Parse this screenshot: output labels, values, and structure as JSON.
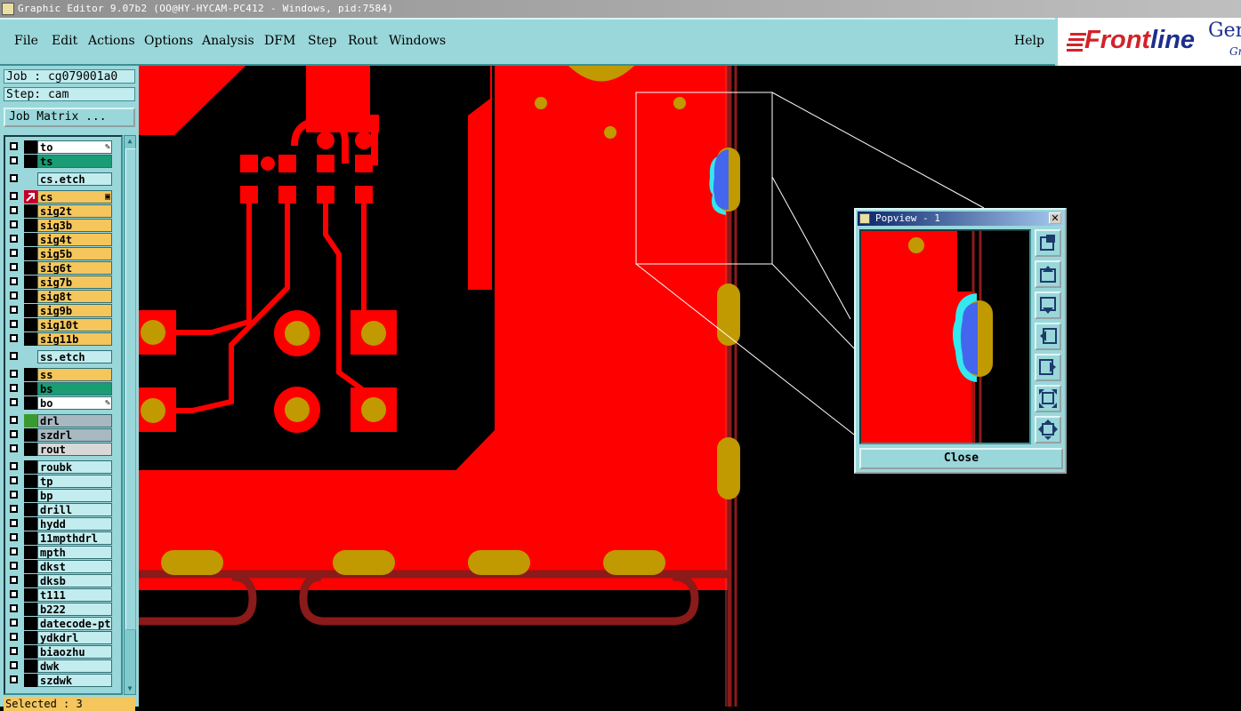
{
  "window": {
    "title": "Graphic Editor 9.07b2 (OO@HY-HYCAM-PC412 - Windows, pid:7584)"
  },
  "menu": {
    "file": "File",
    "edit": "Edit",
    "actions": "Actions",
    "options": "Options",
    "analysis": "Analysis",
    "dfm": "DFM",
    "step": "Step",
    "rout": "Rout",
    "windows": "Windows",
    "help": "Help"
  },
  "brand": {
    "logo_prefix": "Front",
    "logo_suffix": "line",
    "product": "Gen",
    "product_sub": "Gr"
  },
  "job": {
    "job_line": "Job : cg079001a0",
    "step_line": "Step: cam",
    "matrix_button": "Job Matrix ..."
  },
  "layers": [
    {
      "name": "to",
      "color": "#ffffff",
      "marker": "✎",
      "sq": "#000000"
    },
    {
      "name": "ts",
      "color": "#1a9c74",
      "marker": "",
      "sq": "#000000"
    },
    {
      "name": "cs.etch",
      "color": "#c2ecee",
      "marker": "",
      "sq": "#9ad7da"
    },
    {
      "name": "cs",
      "color": "#f5c65c",
      "marker": "▣",
      "sq": "#c0002a"
    },
    {
      "name": "sig2t",
      "color": "#f5c65c",
      "marker": "",
      "sq": "#000000"
    },
    {
      "name": "sig3b",
      "color": "#f5c65c",
      "marker": "",
      "sq": "#000000"
    },
    {
      "name": "sig4t",
      "color": "#f5c65c",
      "marker": "",
      "sq": "#000000"
    },
    {
      "name": "sig5b",
      "color": "#f5c65c",
      "marker": "",
      "sq": "#000000"
    },
    {
      "name": "sig6t",
      "color": "#f5c65c",
      "marker": "",
      "sq": "#000000"
    },
    {
      "name": "sig7b",
      "color": "#f5c65c",
      "marker": "",
      "sq": "#000000"
    },
    {
      "name": "sig8t",
      "color": "#f5c65c",
      "marker": "",
      "sq": "#000000"
    },
    {
      "name": "sig9b",
      "color": "#f5c65c",
      "marker": "",
      "sq": "#000000"
    },
    {
      "name": "sig10t",
      "color": "#f5c65c",
      "marker": "",
      "sq": "#000000"
    },
    {
      "name": "sig11b",
      "color": "#f5c65c",
      "marker": "",
      "sq": "#000000"
    },
    {
      "name": "ss.etch",
      "color": "#c2ecee",
      "marker": "",
      "sq": "#9ad7da"
    },
    {
      "name": "ss",
      "color": "#f5c65c",
      "marker": "",
      "sq": "#000000"
    },
    {
      "name": "bs",
      "color": "#1a9c74",
      "marker": "",
      "sq": "#000000"
    },
    {
      "name": "bo",
      "color": "#ffffff",
      "marker": "✎",
      "sq": "#000000"
    },
    {
      "name": "drl",
      "color": "#a8b8c0",
      "marker": "",
      "sq": "#3a9a30"
    },
    {
      "name": "szdrl",
      "color": "#a8b8c0",
      "marker": "",
      "sq": "#000000"
    },
    {
      "name": "rout",
      "color": "#d8d8d8",
      "marker": "",
      "sq": "#000000"
    },
    {
      "name": "roubk",
      "color": "#c2ecee",
      "marker": "",
      "sq": "#000000"
    },
    {
      "name": "tp",
      "color": "#c2ecee",
      "marker": "",
      "sq": "#000000"
    },
    {
      "name": "bp",
      "color": "#c2ecee",
      "marker": "",
      "sq": "#000000"
    },
    {
      "name": "drill",
      "color": "#c2ecee",
      "marker": "",
      "sq": "#000000"
    },
    {
      "name": "hydd",
      "color": "#c2ecee",
      "marker": "",
      "sq": "#000000"
    },
    {
      "name": "11mpthdrl",
      "color": "#c2ecee",
      "marker": "",
      "sq": "#000000"
    },
    {
      "name": "mpth",
      "color": "#c2ecee",
      "marker": "",
      "sq": "#000000"
    },
    {
      "name": "dkst",
      "color": "#c2ecee",
      "marker": "",
      "sq": "#000000"
    },
    {
      "name": "dksb",
      "color": "#c2ecee",
      "marker": "",
      "sq": "#000000"
    },
    {
      "name": "t111",
      "color": "#c2ecee",
      "marker": "",
      "sq": "#000000"
    },
    {
      "name": "b222",
      "color": "#c2ecee",
      "marker": "",
      "sq": "#000000"
    },
    {
      "name": "datecode-pto",
      "color": "#c2ecee",
      "marker": "",
      "sq": "#000000"
    },
    {
      "name": "ydkdrl",
      "color": "#c2ecee",
      "marker": "",
      "sq": "#000000"
    },
    {
      "name": "biaozhu",
      "color": "#c2ecee",
      "marker": "",
      "sq": "#000000"
    },
    {
      "name": "dwk",
      "color": "#c2ecee",
      "marker": "",
      "sq": "#000000"
    },
    {
      "name": "szdwk",
      "color": "#c2ecee",
      "marker": "",
      "sq": "#000000"
    }
  ],
  "status": {
    "selected": "Selected : 3"
  },
  "popview": {
    "title": "Popview - 1",
    "close": "Close",
    "close_x": "✕"
  },
  "colors": {
    "copper": "#ff0000",
    "pad": "#c09a00",
    "trace": "#8b1a1a",
    "highlight_blue": "#4466ee",
    "highlight_cyan": "#33e8ee",
    "panel": "#9ad7da"
  }
}
